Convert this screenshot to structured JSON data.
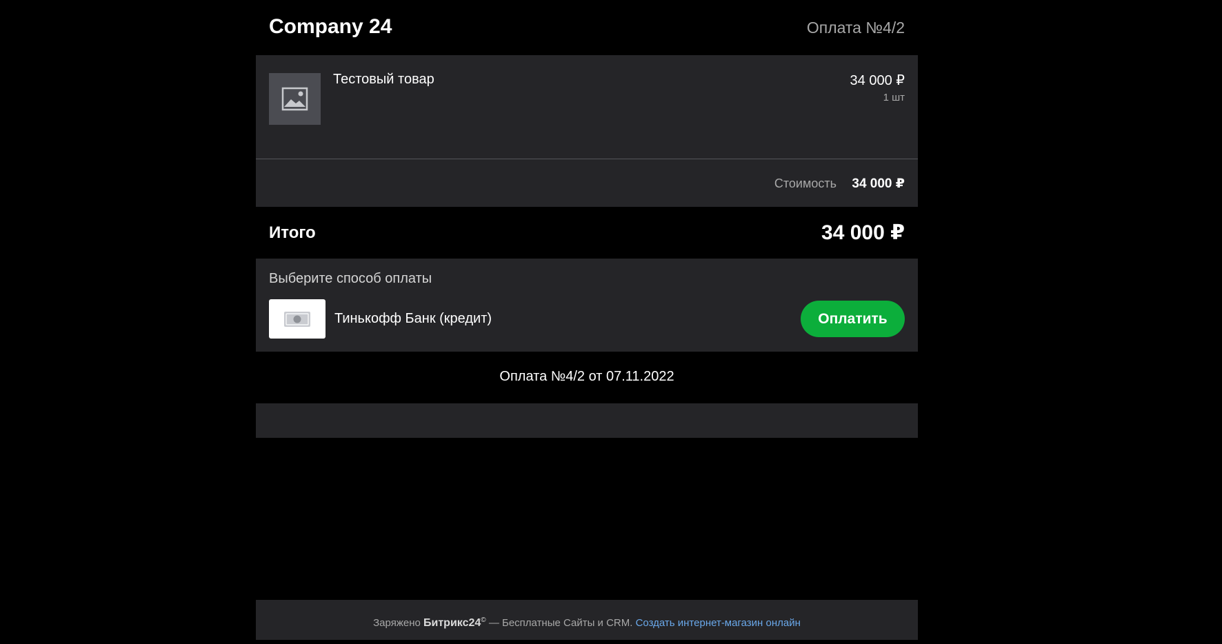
{
  "header": {
    "company": "Company 24",
    "payment_number": "Оплата №4/2"
  },
  "item": {
    "name": "Тестовый товар",
    "price": "34 000 ₽",
    "quantity": "1  шт",
    "icon": "image-placeholder-icon"
  },
  "subtotal": {
    "label": "Стоимость",
    "value": "34 000 ₽"
  },
  "total": {
    "label": "Итого",
    "value": "34 000 ₽"
  },
  "payment": {
    "title": "Выберите способ оплаты",
    "method_name": "Тинькофф Банк (кредит)",
    "method_icon": "cash-icon",
    "button_label": "Оплатить"
  },
  "order_date": "Оплата №4/2 от 07.11.2022",
  "footer": {
    "prefix": "Заряжено",
    "brand": "Битрикс24",
    "clock": "©",
    "middle": " — Бесплатные Сайты и CRM. ",
    "link_text": "Создать интернет-магазин онлайн"
  },
  "colors": {
    "background": "#000000",
    "card": "#252528",
    "accent_green": "#0cae3b",
    "link": "#6aa8ea",
    "muted_text": "#a8a8a8"
  }
}
